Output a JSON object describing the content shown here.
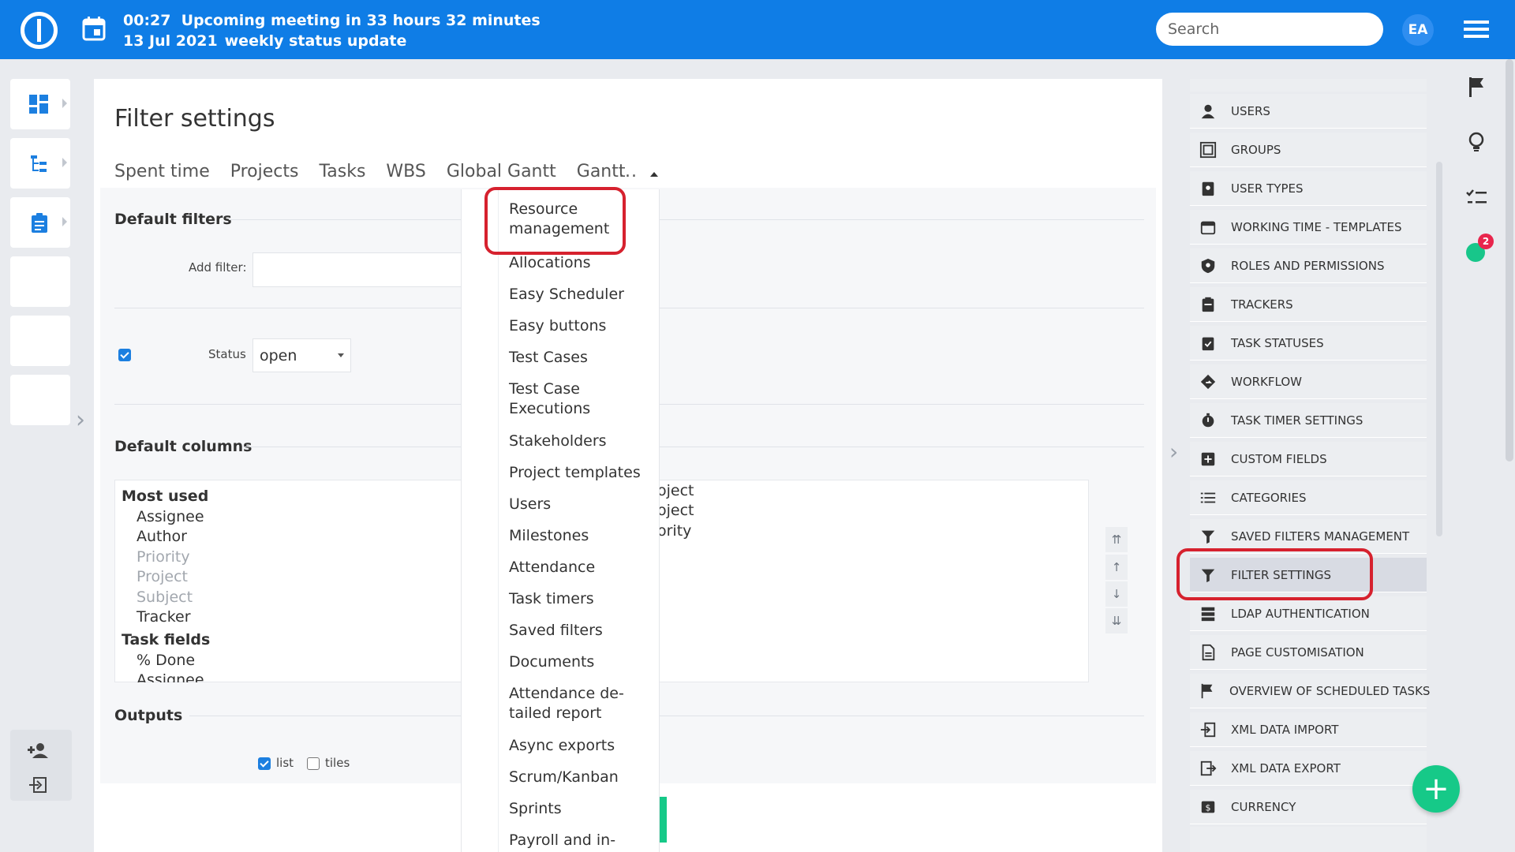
{
  "header": {
    "time": "00:27",
    "meeting_title": "Upcoming meeting in 33 hours 32 minutes",
    "date": "13 Jul 2021",
    "meeting_name": "weekly status update",
    "search_placeholder": "Search",
    "user_initials": "EA"
  },
  "main": {
    "page_title": "Filter settings",
    "tabs": [
      "Spent time",
      "Projects",
      "Tasks",
      "WBS",
      "Global Gantt",
      "Gantt"
    ],
    "more": "...",
    "default_filters": "Default filters",
    "add_filter_label": "Add filter:",
    "status_label": "Status",
    "status_value": "open",
    "default_columns": "Default columns",
    "available_columns": [
      {
        "text": "Most used",
        "group": true
      },
      {
        "text": "Assignee",
        "disabled": false
      },
      {
        "text": "Author",
        "disabled": false
      },
      {
        "text": "Priority",
        "disabled": true
      },
      {
        "text": "Project",
        "disabled": true
      },
      {
        "text": "Subject",
        "disabled": true
      },
      {
        "text": "Tracker",
        "disabled": false
      },
      {
        "text": "Task fields",
        "group": true
      },
      {
        "text": "% Done",
        "disabled": false
      },
      {
        "text": "Assignee",
        "disabled": false
      }
    ],
    "selected_columns": [
      "oject",
      "oject",
      "ority"
    ],
    "move_buttons": [
      "⇈",
      "↑",
      "↓",
      "⇊"
    ],
    "outputs": "Outputs",
    "output_list": "list",
    "output_tiles": "tiles"
  },
  "dropdown": {
    "items": [
      "Resource\nmanagement",
      "Allocations",
      "Easy Scheduler",
      "Easy buttons",
      "Test Cases",
      "Test Case\nExecutions",
      "Stakeholders",
      "Project templates",
      "Users",
      "Milestones",
      "Attendance",
      "Task timers",
      "Saved filters",
      "Documents",
      "Attendance de-\ntailed report",
      "Async exports",
      "Scrum/Kanban",
      "Sprints",
      "Payroll and in-"
    ]
  },
  "admin_menu": {
    "items": [
      {
        "label": "USERS",
        "icon": "user-icon"
      },
      {
        "label": "GROUPS",
        "icon": "group-icon"
      },
      {
        "label": "USER TYPES",
        "icon": "badge-icon"
      },
      {
        "label": "WORKING TIME - TEMPLATES",
        "icon": "calendar-icon"
      },
      {
        "label": "ROLES AND PERMISSIONS",
        "icon": "shield-icon"
      },
      {
        "label": "TRACKERS",
        "icon": "clipboard-icon"
      },
      {
        "label": "TASK STATUSES",
        "icon": "check-clipboard-icon"
      },
      {
        "label": "WORKFLOW",
        "icon": "workflow-icon"
      },
      {
        "label": "TASK TIMER SETTINGS",
        "icon": "stopwatch-icon"
      },
      {
        "label": "CUSTOM FIELDS",
        "icon": "plus-box-icon"
      },
      {
        "label": "CATEGORIES",
        "icon": "list-icon"
      },
      {
        "label": "SAVED FILTERS MANAGEMENT",
        "icon": "filter-icon"
      },
      {
        "label": "FILTER SETTINGS",
        "icon": "filter-icon",
        "active": true
      },
      {
        "label": "LDAP AUTHENTICATION",
        "icon": "server-icon"
      },
      {
        "label": "PAGE CUSTOMISATION",
        "icon": "page-icon"
      },
      {
        "label": "OVERVIEW OF SCHEDULED TASKS",
        "icon": "flag-icon"
      },
      {
        "label": "XML DATA IMPORT",
        "icon": "import-icon"
      },
      {
        "label": "XML DATA EXPORT",
        "icon": "export-icon"
      },
      {
        "label": "CURRENCY",
        "icon": "currency-icon"
      }
    ]
  },
  "right_rail": {
    "badge_count": "2"
  },
  "colors": {
    "topbar": "#0f7de6",
    "accent_green": "#16c988",
    "highlight_red": "#d6212e",
    "checkbox_blue": "#1c7fe0"
  }
}
